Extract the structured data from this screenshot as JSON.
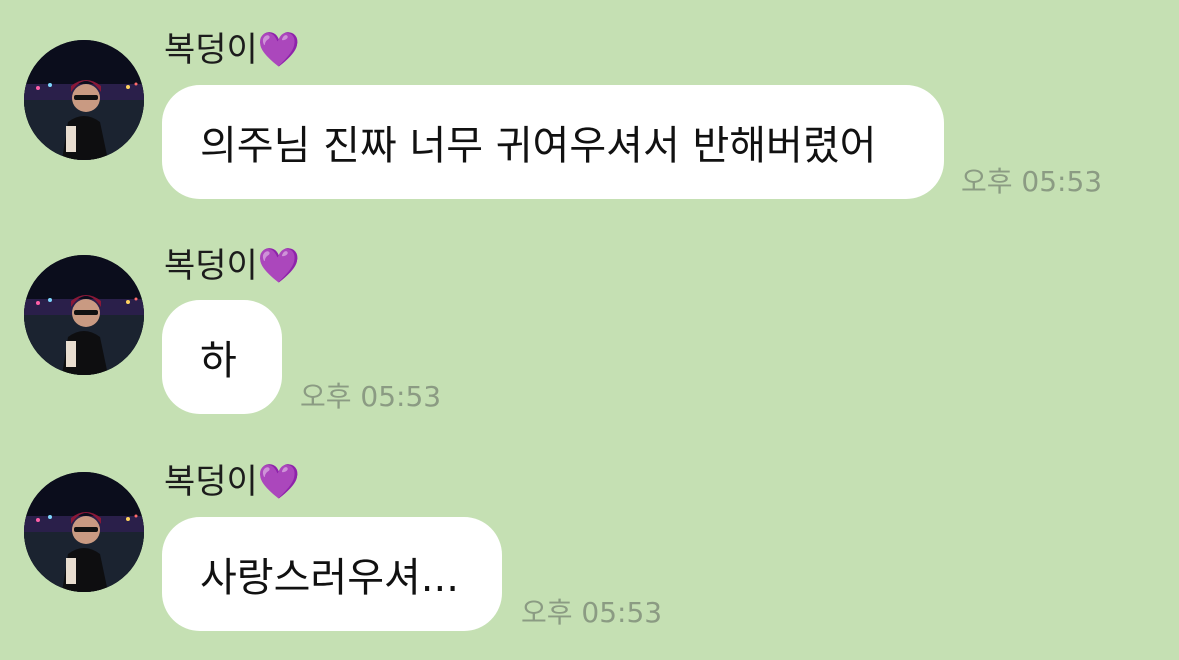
{
  "chat": {
    "messages": [
      {
        "sender": "복덩이💜",
        "avatar_icon": "profile-photo",
        "text": "의주님 진짜 너무 귀여우셔서 반해버렸어",
        "time": "오후 05:53"
      },
      {
        "sender": "복덩이💜",
        "avatar_icon": "profile-photo",
        "text": "하",
        "time": "오후 05:53"
      },
      {
        "sender": "복덩이💜",
        "avatar_icon": "profile-photo",
        "text": "사랑스러우셔...",
        "time": "오후 05:53"
      }
    ]
  },
  "colors": {
    "background": "#c5e0b3",
    "bubble": "#ffffff",
    "timestamp": "#8b9b83",
    "heart": "#9b4fd6"
  }
}
